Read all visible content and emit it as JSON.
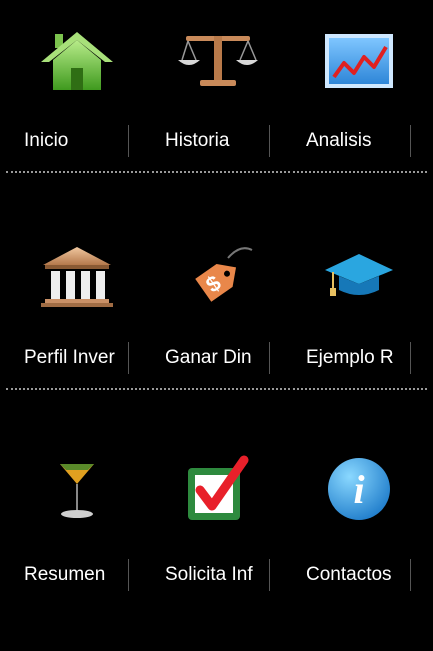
{
  "colors": {
    "background": "#000000",
    "label_text": "#ffffff",
    "divider": "#9a9a9a"
  },
  "menu": {
    "items": [
      {
        "label": "Inicio",
        "icon": "home-icon"
      },
      {
        "label": "Historia",
        "icon": "scales-icon"
      },
      {
        "label": "Analisis",
        "icon": "chart-icon"
      },
      {
        "label": "Perfil Inver",
        "icon": "bank-icon"
      },
      {
        "label": "Ganar Din",
        "icon": "price-tag-icon"
      },
      {
        "label": "Ejemplo R",
        "icon": "graduation-cap-icon"
      },
      {
        "label": "Resumen",
        "icon": "cocktail-glass-icon"
      },
      {
        "label": "Solicita Inf",
        "icon": "checkbox-icon"
      },
      {
        "label": "Contactos",
        "icon": "info-icon"
      }
    ]
  }
}
